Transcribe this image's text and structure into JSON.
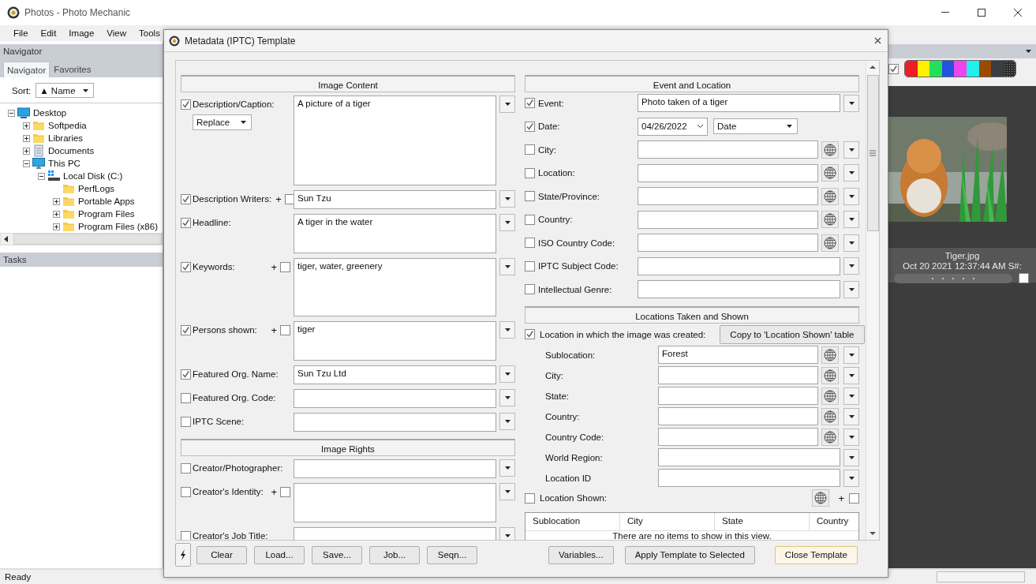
{
  "window": {
    "title": "Photos - Photo Mechanic"
  },
  "menu": [
    "File",
    "Edit",
    "Image",
    "View",
    "Tools"
  ],
  "navigator": {
    "header": "Navigator",
    "tabs": [
      {
        "label": "Navigator",
        "selected": true
      },
      {
        "label": "Favorites",
        "selected": false
      }
    ],
    "sort_label": "Sort:",
    "sort_value": "▲ Name",
    "tree": [
      {
        "label": "Desktop",
        "kind": "desktop",
        "expandable": true,
        "expanded": true,
        "children": [
          {
            "label": "Softpedia",
            "kind": "folder",
            "expandable": true,
            "expanded": false
          },
          {
            "label": "Libraries",
            "kind": "folder",
            "expandable": true,
            "expanded": false
          },
          {
            "label": "Documents",
            "kind": "documents",
            "expandable": true,
            "expanded": false
          },
          {
            "label": "This PC",
            "kind": "pc",
            "expandable": true,
            "expanded": true,
            "children": [
              {
                "label": "Local Disk (C:)",
                "kind": "drive",
                "expandable": true,
                "expanded": true,
                "children": [
                  {
                    "label": "PerfLogs",
                    "kind": "folder",
                    "expandable": false
                  },
                  {
                    "label": "Portable Apps",
                    "kind": "folder",
                    "expandable": true,
                    "expanded": false
                  },
                  {
                    "label": "Program Files",
                    "kind": "folder",
                    "expandable": true,
                    "expanded": false
                  },
                  {
                    "label": "Program Files (x86)",
                    "kind": "folder",
                    "expandable": true,
                    "expanded": false
                  }
                ]
              }
            ]
          }
        ]
      }
    ]
  },
  "tasks": {
    "header": "Tasks"
  },
  "contact_sheet": {
    "color_filter_on": true,
    "color_classes": [
      {
        "kind": "solid",
        "color": "#ee1c24"
      },
      {
        "kind": "solid",
        "color": "#fff200"
      },
      {
        "kind": "solid",
        "color": "#22e05a"
      },
      {
        "kind": "solid",
        "color": "#2452e0"
      },
      {
        "kind": "solid",
        "color": "#ee44ee"
      },
      {
        "kind": "solid",
        "color": "#22eeee"
      },
      {
        "kind": "solid",
        "color": "#9b4a00"
      },
      {
        "kind": "solid",
        "color": "#3a3d44"
      },
      {
        "kind": "dotted",
        "color": "#2c2c2c"
      }
    ],
    "thumbnail": {
      "filename": "Tiger.jpg",
      "info": "Oct 20 2021 12:37:44 AM S#:",
      "tagged": false
    }
  },
  "dialog": {
    "title": "Metadata (IPTC) Template",
    "left": [
      {
        "kind": "section",
        "title": "Image Content"
      },
      {
        "kind": "huge",
        "label": "Description/Caption:",
        "checked": true,
        "value": "A picture of a tiger",
        "mode": "Replace"
      },
      {
        "kind": "line",
        "label": "Description Writers:",
        "checked": true,
        "value": "Sun Tzu",
        "add": {
          "sign": "+",
          "checked": false
        }
      },
      {
        "kind": "small",
        "label": "Headline:",
        "checked": true,
        "value": "A tiger in the water"
      },
      {
        "kind": "medium",
        "label": "Keywords:",
        "checked": true,
        "value": "tiger, water, greenery",
        "add": {
          "sign": "+",
          "checked": false
        }
      },
      {
        "kind": "small",
        "label": "Persons shown:",
        "checked": true,
        "value": "tiger",
        "add": {
          "sign": "+",
          "checked": false
        }
      },
      {
        "kind": "line",
        "label": "Featured Org. Name:",
        "checked": true,
        "value": "Sun Tzu Ltd"
      },
      {
        "kind": "line",
        "label": "Featured Org. Code:",
        "checked": false
      },
      {
        "kind": "line",
        "label": "IPTC Scene:",
        "checked": false
      },
      {
        "kind": "section",
        "title": "Image Rights"
      },
      {
        "kind": "line",
        "label": "Creator/Photographer:",
        "checked": false
      },
      {
        "kind": "small",
        "label": "Creator's Identity:",
        "checked": false,
        "add": {
          "sign": "+",
          "checked": false
        }
      },
      {
        "kind": "small",
        "label": "Creator's Job Title:",
        "checked": false
      }
    ],
    "right": [
      {
        "kind": "section",
        "title": "Event and Location"
      },
      {
        "kind": "field",
        "label": "Event:",
        "checked": true,
        "value": "Photo taken of a tiger"
      },
      {
        "kind": "date",
        "label": "Date:",
        "checked": true,
        "value": "04/26/2022",
        "format": "Date"
      },
      {
        "kind": "geo",
        "label": "City:",
        "checked": false
      },
      {
        "kind": "geo",
        "label": "Location:",
        "checked": false
      },
      {
        "kind": "geo",
        "label": "State/Province:",
        "checked": false
      },
      {
        "kind": "geo",
        "label": "Country:",
        "checked": false
      },
      {
        "kind": "geo",
        "label": "ISO Country Code:",
        "checked": false
      },
      {
        "kind": "field",
        "label": "IPTC Subject Code:",
        "checked": false
      },
      {
        "kind": "field",
        "label": "Intellectual Genre:",
        "checked": false
      },
      {
        "kind": "section",
        "title": "Locations Taken and Shown"
      },
      {
        "kind": "location",
        "label": "Location in which the image was created:",
        "checked": true,
        "button": "Copy to 'Location Shown' table",
        "fields": [
          {
            "kind": "geo",
            "label": "Sublocation:",
            "value": "Forest"
          },
          {
            "kind": "geo",
            "label": "City:"
          },
          {
            "kind": "geo",
            "label": "State:"
          },
          {
            "kind": "geo",
            "label": "Country:"
          },
          {
            "kind": "geo",
            "label": "Country Code:"
          },
          {
            "kind": "field",
            "label": "World Region:"
          },
          {
            "kind": "field",
            "label": "Location ID"
          }
        ]
      },
      {
        "kind": "shown",
        "label": "Location Shown:",
        "checked": false,
        "add": {
          "sign": "+",
          "checked": false
        },
        "columns": [
          "Sublocation",
          "City",
          "State",
          "Country"
        ],
        "empty_text": "There are no items to show in this view."
      }
    ],
    "button_groups": [
      [
        {
          "label": "Clear",
          "default": false
        },
        {
          "label": "Load...",
          "default": false
        },
        {
          "label": "Save...",
          "default": false
        },
        {
          "label": "Job...",
          "default": false
        },
        {
          "label": "Seqn...",
          "default": false
        }
      ],
      [
        {
          "label": "Variables...",
          "default": false
        }
      ],
      [
        {
          "label": "Apply Template to Selected",
          "default": false
        },
        {
          "label": "Close Template",
          "default": true
        }
      ]
    ]
  },
  "status_bar": {
    "text": "Ready"
  }
}
